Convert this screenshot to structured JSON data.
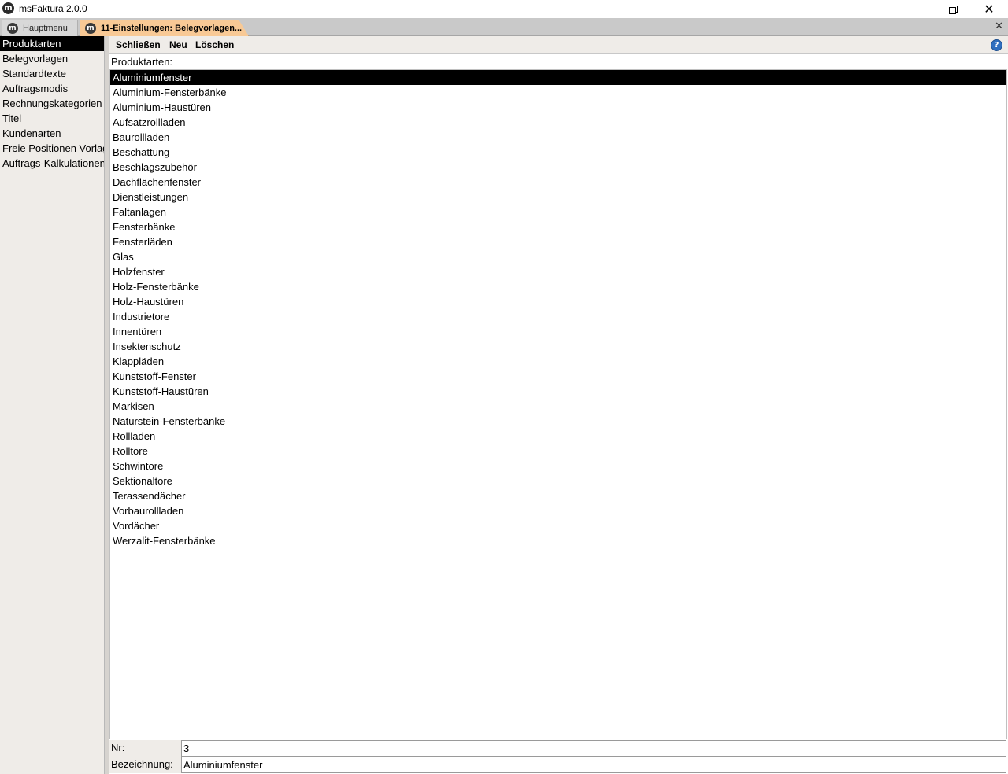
{
  "window": {
    "title": "msFaktura 2.0.0",
    "app_icon_glyph": "m"
  },
  "tabs": {
    "home_label": "Hauptmenu",
    "active_label": "11-Einstellungen: Belegvorlagen...",
    "active_color": "#f8c995"
  },
  "sidebar": {
    "items": [
      {
        "label": "Produktarten",
        "selected": true
      },
      {
        "label": "Belegvorlagen"
      },
      {
        "label": "Standardtexte"
      },
      {
        "label": "Auftragsmodis"
      },
      {
        "label": "Rechnungskategorien"
      },
      {
        "label": "Titel"
      },
      {
        "label": "Kundenarten"
      },
      {
        "label": "Freie Positionen Vorlagen"
      },
      {
        "label": "Auftrags-Kalkulationen"
      }
    ]
  },
  "toolbar": {
    "close_label": "Schließen",
    "new_label": "Neu",
    "delete_label": "Löschen",
    "help_glyph": "?"
  },
  "list": {
    "label": "Produktarten:",
    "selected_index": 0,
    "items": [
      "Aluminiumfenster",
      "Aluminium-Fensterbänke",
      "Aluminium-Haustüren",
      "Aufsatzrollladen",
      "Baurollladen",
      "Beschattung",
      "Beschlagszubehör",
      "Dachflächenfenster",
      "Dienstleistungen",
      "Faltanlagen",
      "Fensterbänke",
      "Fensterläden",
      "Glas",
      "Holzfenster",
      "Holz-Fensterbänke",
      "Holz-Haustüren",
      "Industrietore",
      "Innentüren",
      "Insektenschutz",
      "Klappläden",
      "Kunststoff-Fenster",
      "Kunststoff-Haustüren",
      "Markisen",
      "Naturstein-Fensterbänke",
      "Rollladen",
      "Rolltore",
      "Schwintore",
      "Sektionaltore",
      "Terassendächer",
      "Vorbaurollladen",
      "Vordächer",
      "Werzalit-Fensterbänke"
    ]
  },
  "fields": {
    "nr_label": "Nr:",
    "nr_value": "3",
    "bezeichnung_label": "Bezeichnung:",
    "bezeichnung_value": "Aluminiumfenster"
  }
}
